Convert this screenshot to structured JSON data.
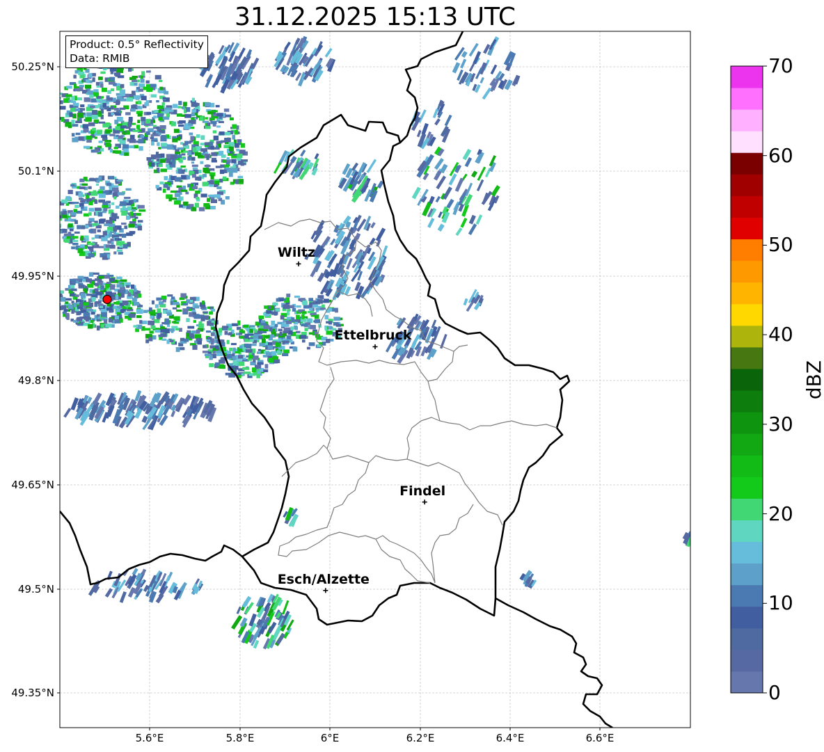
{
  "title": "31.12.2025 15:13 UTC",
  "info": {
    "product": "Product: 0.5° Reflectivity",
    "data": "Data: RMIB"
  },
  "y_ticks": [
    "50.25°N",
    "50.1°N",
    "49.95°N",
    "49.8°N",
    "49.65°N",
    "49.5°N",
    "49.35°N"
  ],
  "x_ticks": [
    "5.6°E",
    "5.8°E",
    "6°E",
    "6.2°E",
    "6.4°E",
    "6.6°E"
  ],
  "cities": [
    {
      "name": "Wiltz",
      "lon": 5.93,
      "lat": 49.966
    },
    {
      "name": "Ettelbruck",
      "lon": 6.1,
      "lat": 49.847
    },
    {
      "name": "Findel",
      "lon": 6.21,
      "lat": 49.624
    },
    {
      "name": "Esch/Alzette",
      "lon": 5.99,
      "lat": 49.497
    }
  ],
  "radar_site": {
    "lon": 5.505,
    "lat": 49.915,
    "color": "#ff0000"
  },
  "extent": {
    "lon": [
      5.4,
      6.8
    ],
    "lat": [
      49.3,
      50.3
    ]
  },
  "colorbar": {
    "label": "dBZ",
    "ticks": [
      "0",
      "10",
      "20",
      "30",
      "40",
      "50",
      "60",
      "70"
    ],
    "range": [
      0,
      70
    ],
    "colors": [
      "#6577ac",
      "#5769a3",
      "#4e6aa1",
      "#405ea0",
      "#4b79b1",
      "#5da0c9",
      "#66bcdb",
      "#5fd6c0",
      "#41d774",
      "#13c91a",
      "#12bb16",
      "#11a814",
      "#0f940f",
      "#0d7d0d",
      "#0a650a",
      "#467710",
      "#adb40c",
      "#ffd800",
      "#ffb500",
      "#ff9900",
      "#ff7e00",
      "#e00000",
      "#c00000",
      "#a00000",
      "#7a0000",
      "#ffe0ff",
      "#ffb0ff",
      "#ff70ff",
      "#ec34ee"
    ]
  }
}
